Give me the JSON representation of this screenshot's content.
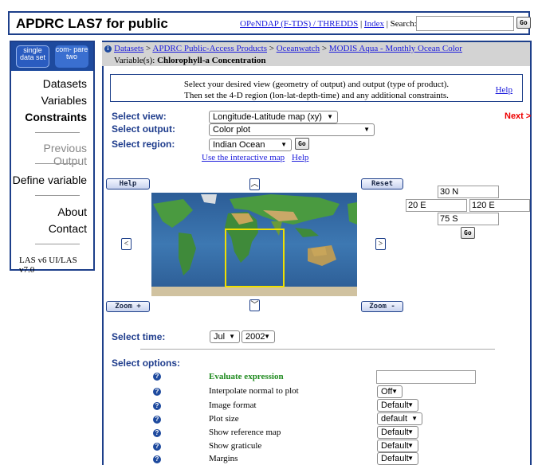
{
  "header": {
    "title": "APDRC LAS7 for public",
    "link1": "OPeNDAP (F-TDS) / THREDDS",
    "sep1": "|",
    "link2": "Index",
    "sep2": "|",
    "search_label": "Search:",
    "search_value": "",
    "go": "Go"
  },
  "sidebar": {
    "tab1": "single data set",
    "tab2": "com- pare two",
    "items": [
      "Datasets",
      "Variables",
      "Constraints",
      "Previous Output",
      "Define variable",
      "About",
      "Contact"
    ],
    "version": "LAS v6 UI/LAS v7.0"
  },
  "breadcrumb": {
    "items": [
      "Datasets",
      "APDRC Public-Access Products",
      "Oceanwatch",
      "MODIS Aqua - Monthly Ocean Color"
    ],
    "sep": ">",
    "variable_label": "Variable(s):",
    "variable_value": "Chlorophyll-a Concentration"
  },
  "instructions": {
    "line1": "Select your desired view (geometry of output) and output (type of product).",
    "line2": "Then set the 4-D region (lon-lat-depth-time) and any additional constraints.",
    "help": "Help"
  },
  "controls": {
    "view_label": "Select view:",
    "view_value": "Longitude-Latitude map (xy)",
    "output_label": "Select output:",
    "output_value": "Color plot",
    "region_label": "Select region:",
    "region_value": "Indian Ocean",
    "go": "Go",
    "interactive_map": "Use the interactive map",
    "help": "Help",
    "next": "Next >"
  },
  "map": {
    "help": "Help",
    "reset": "Reset",
    "zoom_in": "Zoom +",
    "zoom_out": "Zoom -",
    "north": "30 N",
    "west": "20 E",
    "east": "120 E",
    "south": "75 S",
    "go": "Go"
  },
  "time": {
    "label": "Select time:",
    "month": "Jul",
    "year": "2002"
  },
  "options": {
    "label": "Select options:",
    "rows": [
      {
        "label": "Evaluate expression",
        "value": ""
      },
      {
        "label": "Interpolate normal to plot",
        "value": "Off"
      },
      {
        "label": "Image format",
        "value": "Default"
      },
      {
        "label": "Plot size",
        "value": "default"
      },
      {
        "label": "Show reference map",
        "value": "Default"
      },
      {
        "label": "Show graticule",
        "value": "Default"
      },
      {
        "label": "Margins",
        "value": "Default"
      }
    ]
  },
  "colors": {
    "brand_blue": "#1d3f8a",
    "label_blue": "#1e3c8c",
    "next_red": "#e00000",
    "expr_green": "#1e8a1e"
  }
}
